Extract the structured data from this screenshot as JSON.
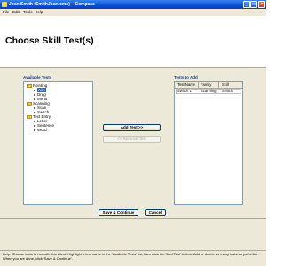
{
  "window": {
    "title": "Joan Smith (SmithJoan.cmo) – Compass",
    "minimize_label": "_",
    "maximize_label": "□",
    "close_label": "×"
  },
  "menu": {
    "items": [
      "File",
      "Edit",
      "Tools",
      "Help"
    ]
  },
  "page": {
    "title": "Choose Skill Test(s)"
  },
  "available_tests": {
    "title": "Available Tests",
    "groups": [
      {
        "label": "Pointing",
        "items": [
          "Aim",
          "Drag",
          "Menu"
        ]
      },
      {
        "label": "Scanning",
        "items": [
          "Scan",
          "Switch"
        ]
      },
      {
        "label": "Text Entry",
        "items": [
          "Letter",
          "Sentence",
          "Word"
        ]
      }
    ],
    "selected_item": "Aim"
  },
  "middle_buttons": {
    "add_label": "Add Test >>",
    "remove_label": "<< Remove Test"
  },
  "tests_to_add": {
    "title": "Tests to Add",
    "columns": [
      "Test Name",
      "Family",
      "Skill"
    ],
    "rows": [
      [
        "Switch 1",
        "Scanning",
        "Switch"
      ]
    ]
  },
  "footer": {
    "save_label": "Save & Continue",
    "cancel_label": "Cancel"
  },
  "help": {
    "text": "Help: Choose tests to run with this client.  Highlight a test name in the 'Available Tests' list, then click the 'Add Test' button.  Add or delete as many tests as you'd like.  When you are done, click 'Save & Continue'."
  },
  "colors": {
    "titlebar": "#0a52d6",
    "panel_title": "#1f3b86",
    "selection": "#316ac5",
    "window_bg": "#ece9d8"
  },
  "icons": {
    "app": "compass-app-icon",
    "group": "folder-icon",
    "item": "bullet-icon"
  }
}
